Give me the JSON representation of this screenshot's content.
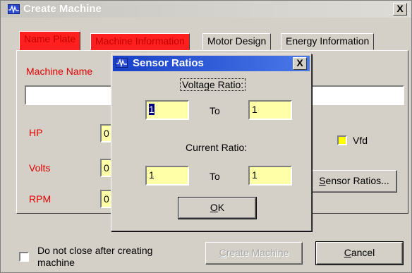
{
  "window": {
    "title": "Create Machine",
    "close_glyph": "X",
    "icon": "waveform-icon"
  },
  "tabs": [
    {
      "label": "Name Plate",
      "highlight": true,
      "selected": true
    },
    {
      "label": "Machine Information",
      "highlight": true,
      "selected": false
    },
    {
      "label": "Motor Design",
      "highlight": false,
      "selected": false
    },
    {
      "label": "Energy Information",
      "highlight": false,
      "selected": false
    }
  ],
  "form": {
    "machine_name_label": "Machine Name",
    "machine_name_value": "",
    "hp_label": "HP",
    "hp_value": "0",
    "volts_label": "Volts",
    "volts_value": "0",
    "rpm_label": "RPM",
    "rpm_value": "0",
    "vfd_label": "Vfd",
    "vfd_checked": false,
    "sensor_ratios_button": "Sensor Ratios...",
    "sensor_ratios_accel": "S",
    "sensor_ratios_rest": "ensor Ratios..."
  },
  "footer": {
    "do_not_close_label": "Do not close after creating machine",
    "do_not_close_checked": false,
    "create_machine_button": "Create Machine",
    "create_machine_accel": "C",
    "create_machine_rest": "reate Machine",
    "cancel_accel": "C",
    "cancel_rest": "ancel"
  },
  "sensor_dialog": {
    "title": "Sensor Ratios",
    "close_glyph": "X",
    "voltage_ratio_label": "Voltage Ratio:",
    "voltage_from": "1",
    "voltage_to": "1",
    "current_ratio_label": "Current Ratio:",
    "current_from": "1",
    "current_to": "1",
    "to_label": "To",
    "ok_accel": "O",
    "ok_rest": "K"
  },
  "colors": {
    "dialog_face": "#d4d0c8",
    "highlight_red": "#ff1f1f",
    "label_red": "#e00000",
    "field_yellow": "#ffffa8",
    "active_title_blue": "#1840c8"
  }
}
